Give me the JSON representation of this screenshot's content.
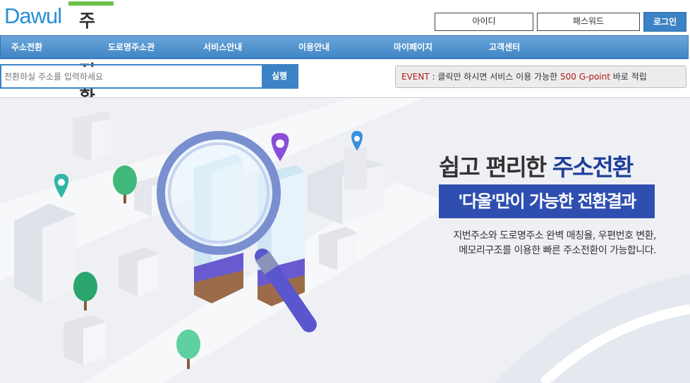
{
  "brand": {
    "logo_en": "Dawul",
    "logo_kr": "주소전환"
  },
  "login": {
    "id_placeholder": "아이디",
    "pw_placeholder": "패스워드",
    "login_label": "로그인"
  },
  "nav": {
    "items": [
      "주소전환",
      "도로명주소관",
      "서비스안내",
      "이용안내",
      "마이페이지",
      "고객센터"
    ]
  },
  "search": {
    "placeholder": "전환하실 주소를 입력하세요",
    "button_label": "실행"
  },
  "event": {
    "label": "EVENT",
    "text_prefix": " : 클릭만 하시면 서비스 이용 가능한 ",
    "highlight": "500 G-point",
    "text_suffix": " 바로 적립"
  },
  "banner": {
    "headline_plain": "쉽고 편리한 ",
    "headline_strong": "주소전환",
    "sub": "'다울'만이 가능한 전환결과",
    "desc_line1": "지번주소와 도로명주소 완벽 매칭율, 우편번호 변환,",
    "desc_line2": "메모리구조를 이용한 빠른 주소전환이 가능합니다."
  },
  "colors": {
    "accent": "#3b83c4",
    "brand_green": "#6cc24a",
    "banner_blue": "#2f4fb0"
  }
}
